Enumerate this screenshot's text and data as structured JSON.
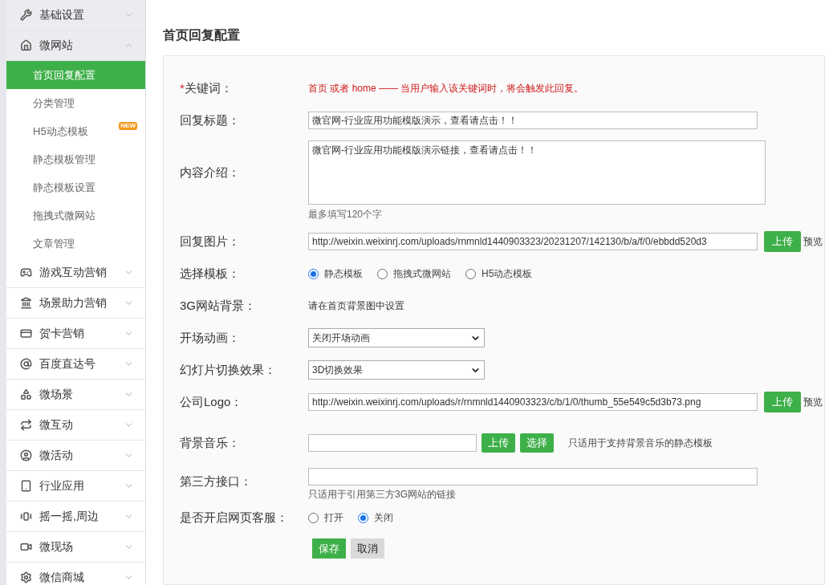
{
  "sidebar": {
    "groups": [
      {
        "label": "基础设置",
        "expanded": false,
        "hovered": true
      },
      {
        "label": "微网站",
        "expanded": true,
        "hovered": true,
        "children": [
          {
            "label": "首页回复配置",
            "selected": true
          },
          {
            "label": "分类管理",
            "selected": false
          },
          {
            "label": "H5动态模板",
            "selected": false,
            "badge": "NEW"
          },
          {
            "label": "静态模板管理",
            "selected": false
          },
          {
            "label": "静态模板设置",
            "selected": false
          },
          {
            "label": "拖拽式微网站",
            "selected": false
          },
          {
            "label": "文章管理",
            "selected": false
          }
        ]
      },
      {
        "label": "游戏互动营销",
        "expanded": false,
        "hovered": false
      },
      {
        "label": "场景助力营销",
        "expanded": false,
        "hovered": false
      },
      {
        "label": "贺卡营销",
        "expanded": false,
        "hovered": false
      },
      {
        "label": "百度直达号",
        "expanded": false,
        "hovered": false
      },
      {
        "label": "微场景",
        "expanded": false,
        "hovered": false
      },
      {
        "label": "微互动",
        "expanded": false,
        "hovered": false
      },
      {
        "label": "微活动",
        "expanded": false,
        "hovered": false
      },
      {
        "label": "行业应用",
        "expanded": false,
        "hovered": false
      },
      {
        "label": "摇一摇,周边",
        "expanded": false,
        "hovered": false
      },
      {
        "label": "微现场",
        "expanded": false,
        "hovered": false
      },
      {
        "label": "微信商城",
        "expanded": false,
        "hovered": false
      }
    ]
  },
  "page": {
    "title": "首页回复配置"
  },
  "form": {
    "rows": [
      {
        "kind": "note",
        "marker": "*",
        "label": "关键词：",
        "text": "首页 或者 home —— 当用户输入该关键词时，将会触发此回复。"
      },
      {
        "kind": "input",
        "label": "回复标题：",
        "value": "微官网-行业应用功能模版演示，查看请点击！！"
      },
      {
        "kind": "textarea",
        "label": "内容介绍：",
        "value": "微官网-行业应用功能模版演示链接，查看请点击！！",
        "hint": "最多填写120个字"
      },
      {
        "kind": "upload",
        "label": "回复图片：",
        "value": "http://weixin.weixinrj.com/uploads/rnmnld1440903323/20231207/142130/b/a/f/0/ebbdd520d3",
        "buttons": [
          "上传"
        ],
        "link": "预览"
      },
      {
        "kind": "radio",
        "label": "选择模板：",
        "options": [
          {
            "label": "静态模板",
            "selected": true
          },
          {
            "label": "拖拽式微网站",
            "selected": false
          },
          {
            "label": "H5动态模板",
            "selected": false
          }
        ]
      },
      {
        "kind": "static",
        "label": "3G网站背景：",
        "text": "请在首页背景图中设置"
      },
      {
        "kind": "select",
        "label": "开场动画：",
        "value": "关闭开场动画"
      },
      {
        "kind": "select",
        "label": "幻灯片切换效果：",
        "value": "3D切换效果"
      },
      {
        "kind": "upload",
        "label": "公司Logo：",
        "value": "http://weixin.weixinrj.com/uploads/r/rnmnld1440903323/c/b/1/0/thumb_55e549c5d3b73.png",
        "buttons": [
          "上传"
        ],
        "link": "预览"
      },
      {
        "kind": "music",
        "label": "背景音乐：",
        "buttons": [
          "上传",
          "选择"
        ],
        "note": "只适用于支持背景音乐的静态模板"
      },
      {
        "kind": "hinted",
        "label": "第三方接口：",
        "hint": "只适用于引用第三方3G网站的链接"
      },
      {
        "kind": "radio",
        "label": "是否开启网页客服：",
        "options": [
          {
            "label": "打开",
            "selected": false
          },
          {
            "label": "关闭",
            "selected": true
          }
        ]
      }
    ],
    "actions": [
      {
        "label": "保存",
        "kind": "primary"
      },
      {
        "label": "取消",
        "kind": "secondary"
      }
    ]
  }
}
